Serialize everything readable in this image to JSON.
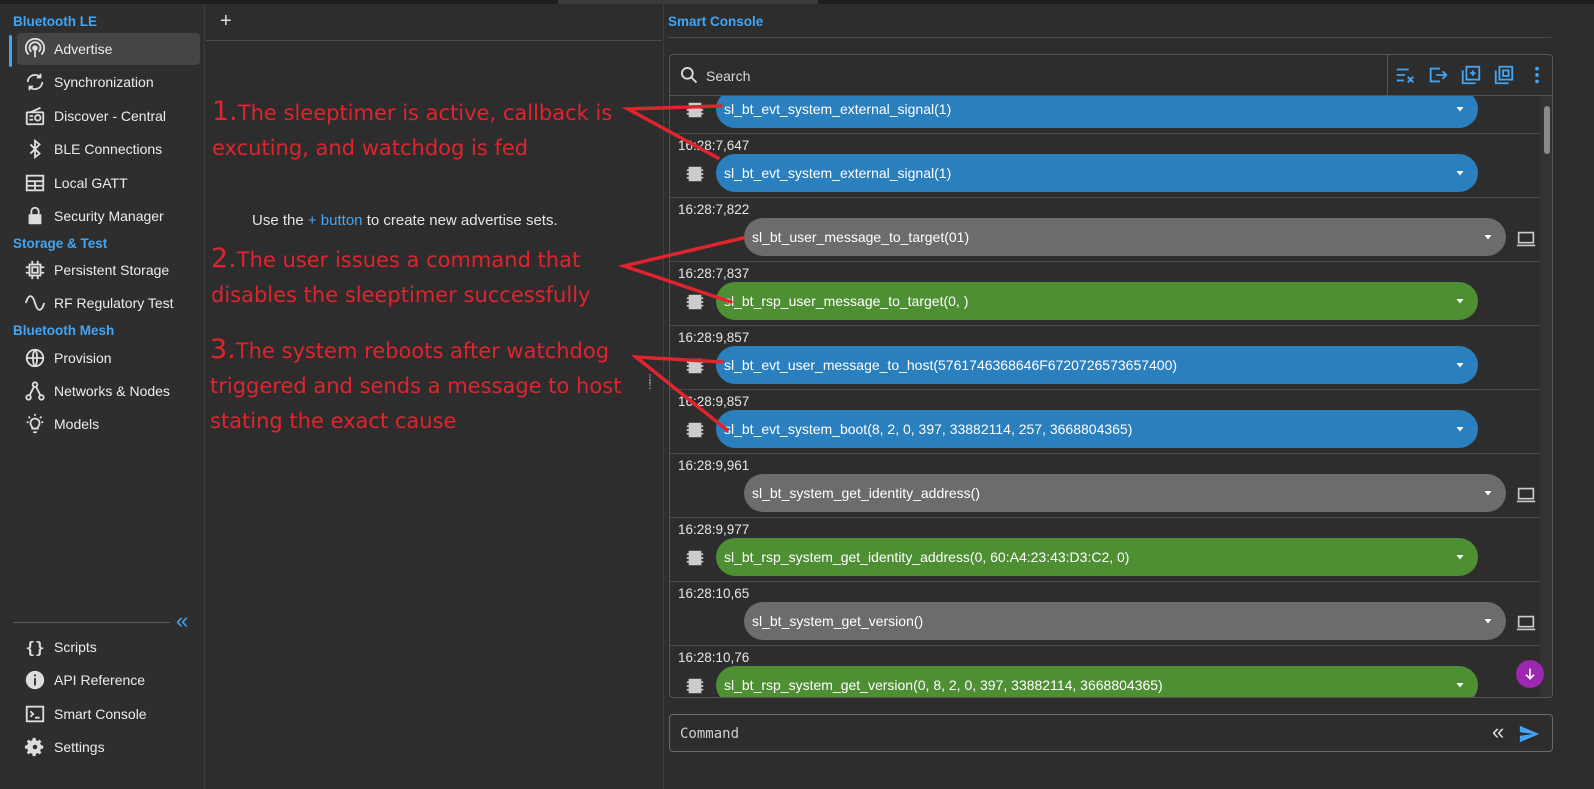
{
  "sidebar": {
    "sections": [
      {
        "title": "Bluetooth LE"
      },
      {
        "title": "Storage & Test"
      },
      {
        "title": "Bluetooth Mesh"
      }
    ],
    "items": [
      {
        "label": "Advertise",
        "icon": "advertise-icon"
      },
      {
        "label": "Synchronization",
        "icon": "sync-icon"
      },
      {
        "label": "Discover - Central",
        "icon": "radio-icon"
      },
      {
        "label": "BLE Connections",
        "icon": "bluetooth-icon"
      },
      {
        "label": "Local GATT",
        "icon": "table-icon"
      },
      {
        "label": "Security Manager",
        "icon": "lock-icon"
      },
      {
        "label": "Persistent Storage",
        "icon": "chip-icon"
      },
      {
        "label": "RF Regulatory Test",
        "icon": "wave-icon"
      },
      {
        "label": "Provision",
        "icon": "globe-icon"
      },
      {
        "label": "Networks & Nodes",
        "icon": "network-icon"
      },
      {
        "label": "Models",
        "icon": "lightbulb-icon"
      }
    ],
    "bottom": [
      {
        "label": "Scripts",
        "icon": "braces-icon"
      },
      {
        "label": "API Reference",
        "icon": "info-icon"
      },
      {
        "label": "Smart Console",
        "icon": "terminal-icon"
      },
      {
        "label": "Settings",
        "icon": "gear-icon"
      }
    ]
  },
  "middle": {
    "add_label": "+",
    "hint_prefix": "Use the",
    "hint_button": "+ button",
    "hint_suffix": "to create new advertise sets."
  },
  "annotations": [
    {
      "num": "1.",
      "line1": "The sleeptimer is active, callback is",
      "line2": "excuting, and watchdog is fed"
    },
    {
      "num": "2.",
      "line1": "The user issues a command that",
      "line2": "disables the sleeptimer successfully"
    },
    {
      "num": "3.",
      "line1": "The system reboots after watchdog",
      "line2": "triggered and sends a message to host",
      "line3": "stating the exact cause"
    }
  ],
  "console": {
    "title": "Smart Console",
    "search_placeholder": "Search",
    "command_placeholder": "Command",
    "colors": {
      "event": "#2a7fbf",
      "response": "#4e8f34",
      "command": "#6c6c6c",
      "accent": "#42a5f5",
      "fab": "#9c27b0"
    },
    "messages": [
      {
        "time": "",
        "kind": "event",
        "text": "sl_bt_evt_system_external_signal(1)"
      },
      {
        "time": "16:28:7,647",
        "kind": "event",
        "text": "sl_bt_evt_system_external_signal(1)"
      },
      {
        "time": "16:28:7,822",
        "kind": "command",
        "text": "sl_bt_user_message_to_target(01)"
      },
      {
        "time": "16:28:7,837",
        "kind": "response",
        "text": "sl_bt_rsp_user_message_to_target(0, )"
      },
      {
        "time": "16:28:9,857",
        "kind": "event",
        "text": "sl_bt_evt_user_message_to_host(5761746368646F6720726573657400)"
      },
      {
        "time": "16:28:9,857",
        "kind": "event",
        "text": "sl_bt_evt_system_boot(8, 2, 0, 397, 33882114, 257, 3668804365)"
      },
      {
        "time": "16:28:9,961",
        "kind": "command",
        "text": "sl_bt_system_get_identity_address()"
      },
      {
        "time": "16:28:9,977",
        "kind": "response",
        "text": "sl_bt_rsp_system_get_identity_address(0, 60:A4:23:43:D3:C2, 0)"
      },
      {
        "time": "16:28:10,65",
        "kind": "command",
        "text": "sl_bt_system_get_version()"
      },
      {
        "time": "16:28:10,76",
        "kind": "response",
        "text": "sl_bt_rsp_system_get_version(0, 8, 2, 0, 397, 33882114, 3668804365)"
      }
    ]
  }
}
